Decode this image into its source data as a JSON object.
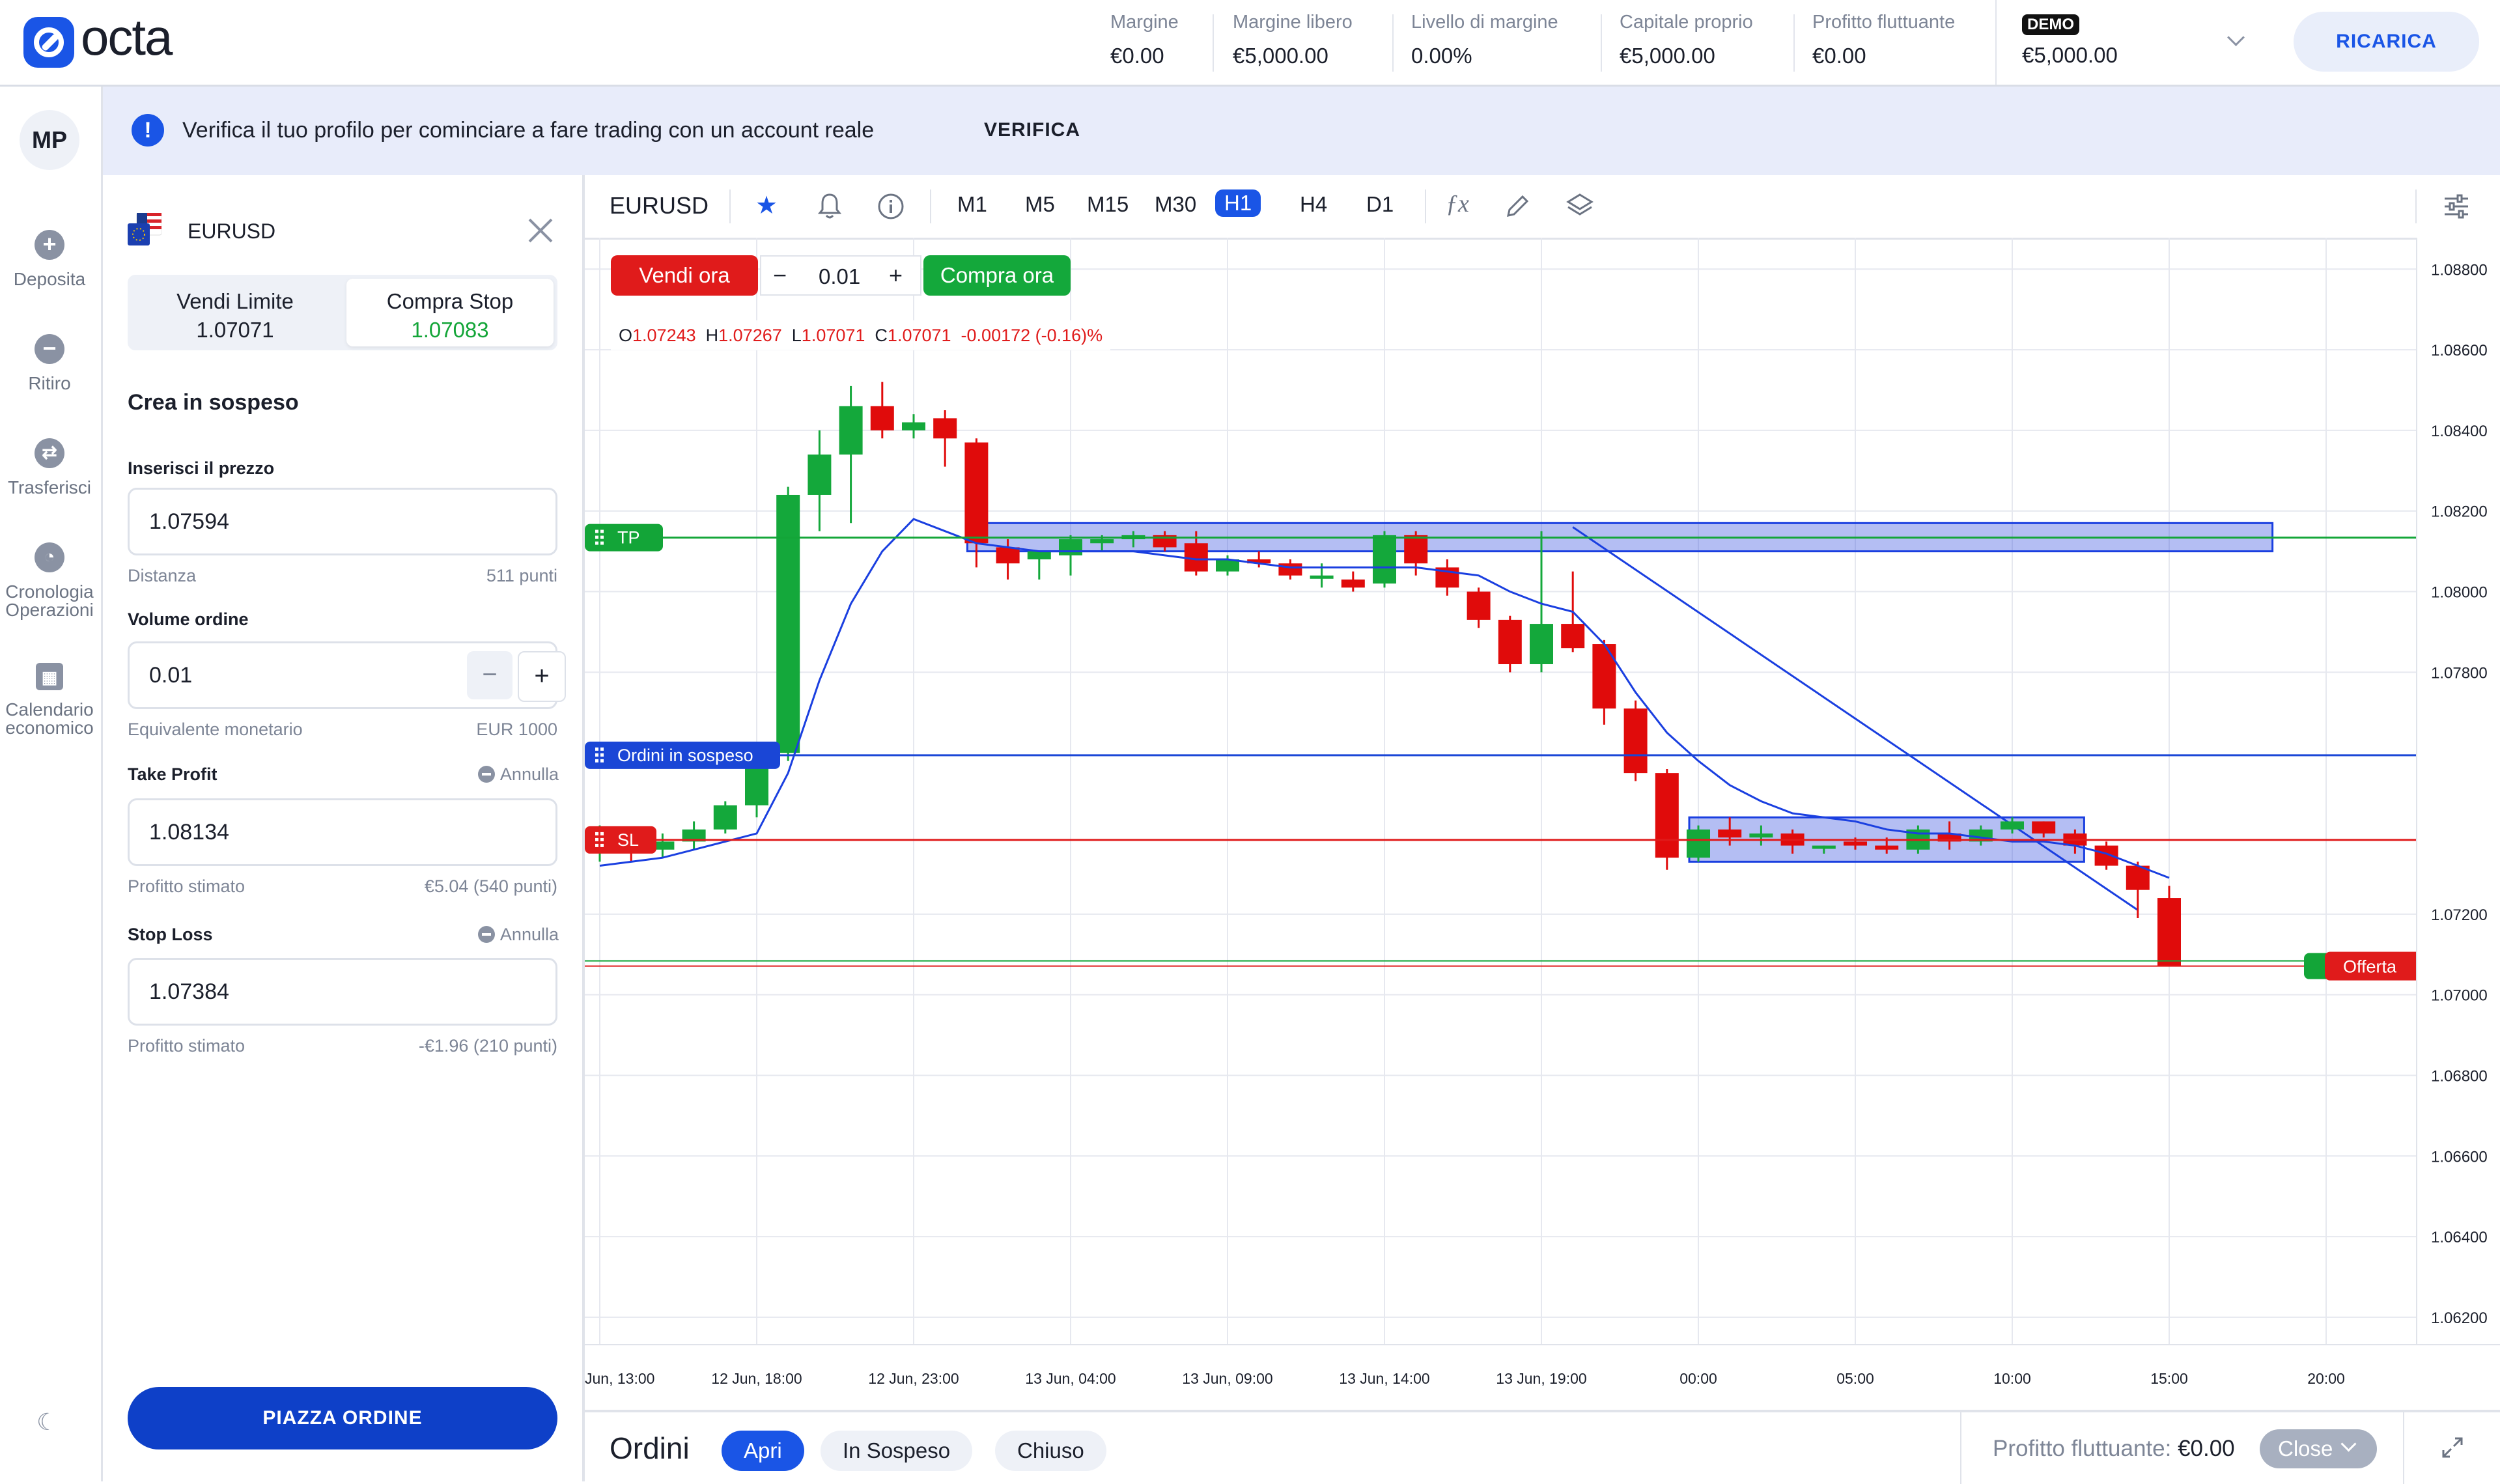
{
  "app": {
    "logo_text": "octa"
  },
  "header": {
    "stats": [
      {
        "label": "Margine",
        "value": "€0.00"
      },
      {
        "label": "Margine libero",
        "value": "€5,000.00"
      },
      {
        "label": "Livello di margine",
        "value": "0.00%"
      },
      {
        "label": "Capitale proprio",
        "value": "€5,000.00"
      },
      {
        "label": "Profitto fluttuante",
        "value": "€0.00"
      }
    ],
    "account": {
      "badge": "DEMO",
      "value": "€5,000.00"
    },
    "ricarica": "RICARICA"
  },
  "leftnav": {
    "avatar": "MP",
    "items": [
      {
        "label": "Deposita",
        "icon": "plus-circle-icon"
      },
      {
        "label": "Ritiro",
        "icon": "minus-circle-icon"
      },
      {
        "label": "Trasferisci",
        "icon": "transfer-icon"
      },
      {
        "label": "Cronologia Operazioni",
        "icon": "history-icon"
      },
      {
        "label": "Calendario economico",
        "icon": "calendar-icon"
      }
    ],
    "theme_icon": "moon-icon"
  },
  "banner": {
    "text": "Verifica il tuo profilo per cominciare a fare trading con un account reale",
    "action": "VERIFICA"
  },
  "panel": {
    "symbol": "EURUSD",
    "tabs": [
      {
        "title": "Vendi Limite",
        "price": "1.07071"
      },
      {
        "title": "Compra Stop",
        "price": "1.07083"
      }
    ],
    "section_title": "Crea in sospeso",
    "price_label": "Inserisci il prezzo",
    "price_value": "1.07594",
    "distance_label": "Distanza",
    "distance_value": "511 punti",
    "volume_label": "Volume ordine",
    "volume_value": "0.01",
    "equiv_label": "Equivalente monetario",
    "equiv_value": "EUR 1000",
    "tp_label": "Take Profit",
    "tp_cancel": "Annulla",
    "tp_value": "1.08134",
    "tp_est_label": "Profitto stimato",
    "tp_est_value": "€5.04 (540 punti)",
    "sl_label": "Stop Loss",
    "sl_cancel": "Annulla",
    "sl_value": "1.07384",
    "sl_est_label": "Profitto stimato",
    "sl_est_value": "-€1.96 (210 punti)",
    "place_button": "PIAZZA ORDINE"
  },
  "chart_toolbar": {
    "symbol": "EURUSD",
    "timeframes": [
      "M1",
      "M5",
      "M15",
      "M30",
      "H1",
      "H4",
      "D1"
    ],
    "active_timeframe": "H1"
  },
  "trade_bar": {
    "sell": "Vendi ora",
    "qty": "0.01",
    "buy": "Compra ora"
  },
  "ohlc": {
    "o": "1.07243",
    "h": "1.07267",
    "l": "1.07071",
    "c": "1.07071",
    "change": "-0.00172 (-0.16)%"
  },
  "chart_data": {
    "type": "candlestick",
    "symbol": "EURUSD",
    "timeframe": "H1",
    "y_ticks": [
      "1.08800",
      "1.08600",
      "1.08400",
      "1.08200",
      "1.08000",
      "1.07800",
      "1.07200",
      "1.07000",
      "1.06800",
      "1.06600",
      "1.06400",
      "1.06200"
    ],
    "ylim": [
      1.0612,
      1.0888
    ],
    "x_ticks": [
      {
        "label": "Jun, 13:00",
        "i": 0
      },
      {
        "label": "12 Jun, 18:00",
        "i": 5
      },
      {
        "label": "12 Jun, 23:00",
        "i": 10
      },
      {
        "label": "13 Jun, 04:00",
        "i": 15
      },
      {
        "label": "13 Jun, 09:00",
        "i": 20
      },
      {
        "label": "13 Jun, 14:00",
        "i": 25
      },
      {
        "label": "13 Jun, 19:00",
        "i": 30
      },
      {
        "label": "00:00",
        "i": 35
      },
      {
        "label": "05:00",
        "i": 40
      },
      {
        "label": "10:00",
        "i": 45
      },
      {
        "label": "15:00",
        "i": 50
      },
      {
        "label": "20:00",
        "i": 55
      }
    ],
    "candles": [
      [
        1.0737,
        1.0742,
        1.0733,
        1.074
      ],
      [
        1.074,
        1.0741,
        1.0733,
        1.0736
      ],
      [
        1.0736,
        1.074,
        1.0734,
        1.0738
      ],
      [
        1.0738,
        1.0743,
        1.0736,
        1.0741
      ],
      [
        1.0741,
        1.0748,
        1.074,
        1.0747
      ],
      [
        1.0747,
        1.0762,
        1.0744,
        1.076
      ],
      [
        1.076,
        1.0826,
        1.0758,
        1.0824
      ],
      [
        1.0824,
        1.084,
        1.0815,
        1.0834
      ],
      [
        1.0834,
        1.0851,
        1.0817,
        1.0846
      ],
      [
        1.0846,
        1.0852,
        1.0838,
        1.084
      ],
      [
        1.084,
        1.0844,
        1.0838,
        1.0842
      ],
      [
        1.0843,
        1.0845,
        1.0831,
        1.0838
      ],
      [
        1.0837,
        1.0838,
        1.0806,
        1.0812
      ],
      [
        1.0811,
        1.0813,
        1.0803,
        1.0807
      ],
      [
        1.0808,
        1.081,
        1.0803,
        1.081
      ],
      [
        1.0809,
        1.0814,
        1.0804,
        1.0813
      ],
      [
        1.0812,
        1.0814,
        1.081,
        1.0813
      ],
      [
        1.0813,
        1.0815,
        1.0811,
        1.0814
      ],
      [
        1.0814,
        1.0815,
        1.081,
        1.0811
      ],
      [
        1.0812,
        1.0815,
        1.0804,
        1.0805
      ],
      [
        1.0805,
        1.0809,
        1.0804,
        1.0808
      ],
      [
        1.0808,
        1.081,
        1.0806,
        1.0807
      ],
      [
        1.0807,
        1.0808,
        1.0803,
        1.0804
      ],
      [
        1.0804,
        1.0807,
        1.0801,
        1.0804
      ],
      [
        1.0803,
        1.0805,
        1.08,
        1.0801
      ],
      [
        1.0802,
        1.0815,
        1.0801,
        1.0814
      ],
      [
        1.0814,
        1.0815,
        1.0804,
        1.0807
      ],
      [
        1.0806,
        1.0808,
        1.0799,
        1.0801
      ],
      [
        1.08,
        1.0801,
        1.0791,
        1.0793
      ],
      [
        1.0793,
        1.0794,
        1.078,
        1.0782
      ],
      [
        1.0782,
        1.0815,
        1.078,
        1.0792
      ],
      [
        1.0792,
        1.0805,
        1.0785,
        1.0786
      ],
      [
        1.0787,
        1.0788,
        1.0767,
        1.0771
      ],
      [
        1.0771,
        1.0773,
        1.0753,
        1.0755
      ],
      [
        1.0755,
        1.0756,
        1.0731,
        1.0734
      ],
      [
        1.0734,
        1.0742,
        1.0733,
        1.0741
      ],
      [
        1.0741,
        1.0744,
        1.0737,
        1.0739
      ],
      [
        1.0739,
        1.0742,
        1.0737,
        1.074
      ],
      [
        1.074,
        1.0741,
        1.0735,
        1.0737
      ],
      [
        1.0737,
        1.0737,
        1.0735,
        1.0737
      ],
      [
        1.0738,
        1.0739,
        1.0736,
        1.0737
      ],
      [
        1.0737,
        1.0739,
        1.0735,
        1.0736
      ],
      [
        1.0736,
        1.0742,
        1.0735,
        1.0741
      ],
      [
        1.074,
        1.0743,
        1.0736,
        1.0738
      ],
      [
        1.0738,
        1.0742,
        1.0737,
        1.0741
      ],
      [
        1.0741,
        1.0744,
        1.074,
        1.0743
      ],
      [
        1.0743,
        1.0743,
        1.0739,
        1.074
      ],
      [
        1.074,
        1.0741,
        1.0735,
        1.0737
      ],
      [
        1.0737,
        1.0738,
        1.0731,
        1.0732
      ],
      [
        1.0732,
        1.0733,
        1.0719,
        1.0726
      ],
      [
        1.0724,
        1.0727,
        1.0707,
        1.0707
      ]
    ],
    "ma": [
      1.0732,
      1.0733,
      1.0734,
      1.0736,
      1.0738,
      1.074,
      1.0755,
      1.0778,
      1.0797,
      1.081,
      1.0818,
      1.0815,
      1.0812,
      1.0811,
      1.081,
      1.081,
      1.081,
      1.081,
      1.0809,
      1.0808,
      1.0808,
      1.0807,
      1.0806,
      1.0806,
      1.0806,
      1.0806,
      1.0806,
      1.0805,
      1.0804,
      1.08,
      1.0797,
      1.0795,
      1.0787,
      1.0775,
      1.0765,
      1.0758,
      1.0752,
      1.0748,
      1.0745,
      1.0744,
      1.0743,
      1.0741,
      1.074,
      1.074,
      1.0739,
      1.0738,
      1.0738,
      1.0737,
      1.0735,
      1.0732,
      1.0729
    ],
    "levels": {
      "tp": {
        "label": "TP",
        "price": 1.08134,
        "price_label": "1.08134",
        "color": "#13a538"
      },
      "pending": {
        "label": "Ordini in sospeso",
        "price": 1.07594,
        "price_label": "1.07594",
        "color": "#1a46d6"
      },
      "sl": {
        "label": "SL",
        "price": 1.07384,
        "price_label": "1.07384",
        "color": "#e01b1b"
      },
      "bid": {
        "label": "Offerta",
        "price": 1.07071,
        "price_label": "1.07071",
        "color": "#e01b1b"
      }
    },
    "rectangles": [
      {
        "i0": 12,
        "i1": 53,
        "y0": 1.081,
        "y1": 1.0817
      },
      {
        "i0": 35,
        "i1": 47,
        "y0": 1.0733,
        "y1": 1.0744
      }
    ],
    "trendline": [
      {
        "i": 31,
        "y": 1.0816
      },
      {
        "i": 49,
        "y": 1.0721
      }
    ],
    "colors": {
      "up": "#14a83b",
      "down": "#e00b0b",
      "ma": "#1a3fe0",
      "grid": "#e6e8ef"
    }
  },
  "orders": {
    "title": "Ordini",
    "tabs": [
      "Apri",
      "In Sospeso",
      "Chiuso"
    ],
    "floating_label": "Profitto fluttuante:",
    "floating_value": "€0.00",
    "close": "Close"
  }
}
